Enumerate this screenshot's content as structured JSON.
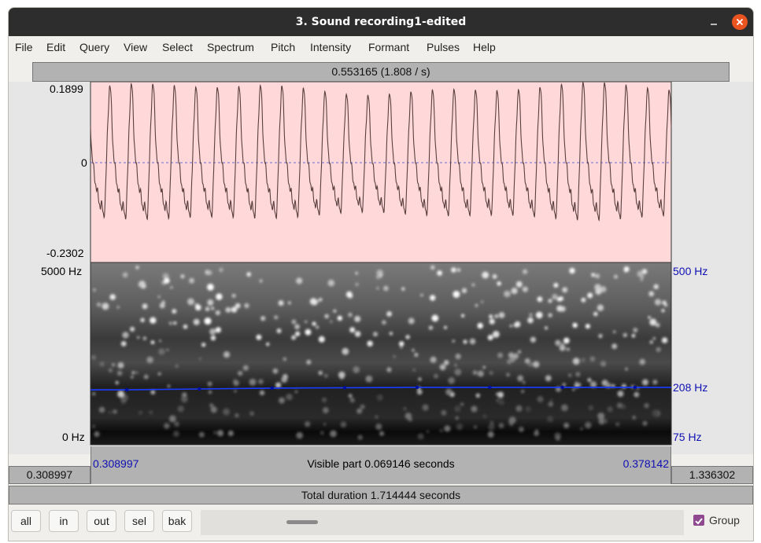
{
  "window": {
    "title": "3. Sound recording1-edited"
  },
  "menu": [
    "File",
    "Edit",
    "Query",
    "View",
    "Select",
    "Spectrum",
    "Pitch",
    "Intensity",
    "Formant",
    "Pulses",
    "Help"
  ],
  "cursor_bar": {
    "text": "0.553165 (1.808 / s)"
  },
  "waveform": {
    "ymax": "0.1899",
    "zero": "0",
    "ymin": "-0.2302",
    "cycles": 27
  },
  "spectrogram": {
    "top_label": "5000 Hz",
    "bottom_label": "0 Hz"
  },
  "pitch": {
    "top_label": "500 Hz",
    "value_label": "208 Hz",
    "bottom_label": "75 Hz",
    "values_hz": [
      203,
      205,
      207,
      208,
      209,
      209,
      209,
      209
    ]
  },
  "time_window": {
    "start": "0.308997",
    "end": "0.378142",
    "visible_text": "Visible part 0.069146 seconds"
  },
  "outside": {
    "left": "0.308997",
    "right": "1.336302"
  },
  "total_text": "Total duration 1.714444 seconds",
  "buttons": {
    "all": "all",
    "in": "in",
    "out": "out",
    "sel": "sel",
    "bak": "bak"
  },
  "group": {
    "label": "Group",
    "checked": true
  },
  "colors": {
    "waveform_bg": "#ffd9d9",
    "pitch_line": "#1a3cff",
    "title_bg": "#2d2d2d",
    "close": "#e95420"
  }
}
